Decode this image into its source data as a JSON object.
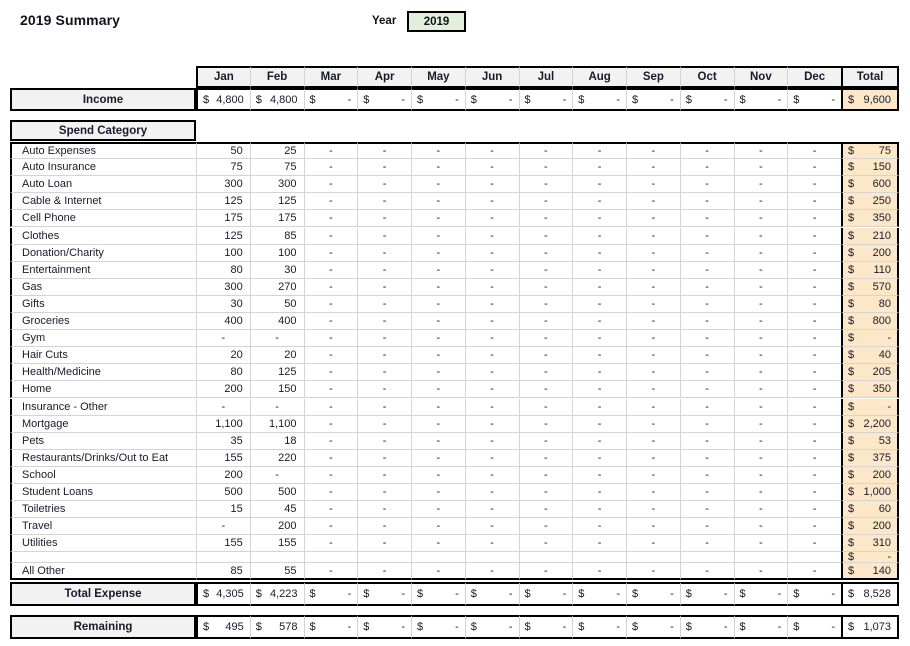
{
  "title": "2019 Summary",
  "year_field": {
    "label": "Year",
    "value": "2019"
  },
  "columns": {
    "months": [
      "Jan",
      "Feb",
      "Mar",
      "Apr",
      "May",
      "Jun",
      "Jul",
      "Aug",
      "Sep",
      "Oct",
      "Nov",
      "Dec"
    ],
    "total": "Total"
  },
  "income": {
    "label": "Income",
    "currency": "$",
    "values": [
      "4,800",
      "4,800",
      "-",
      "-",
      "-",
      "-",
      "-",
      "-",
      "-",
      "-",
      "-",
      "-"
    ],
    "total": "9,600"
  },
  "spend_header": "Spend Category",
  "categories": [
    {
      "name": "Auto Expenses",
      "values": [
        "50",
        "25",
        "-",
        "-",
        "-",
        "-",
        "-",
        "-",
        "-",
        "-",
        "-",
        "-"
      ],
      "total": "75"
    },
    {
      "name": "Auto Insurance",
      "values": [
        "75",
        "75",
        "-",
        "-",
        "-",
        "-",
        "-",
        "-",
        "-",
        "-",
        "-",
        "-"
      ],
      "total": "150"
    },
    {
      "name": "Auto Loan",
      "values": [
        "300",
        "300",
        "-",
        "-",
        "-",
        "-",
        "-",
        "-",
        "-",
        "-",
        "-",
        "-"
      ],
      "total": "600"
    },
    {
      "name": "Cable & Internet",
      "values": [
        "125",
        "125",
        "-",
        "-",
        "-",
        "-",
        "-",
        "-",
        "-",
        "-",
        "-",
        "-"
      ],
      "total": "250"
    },
    {
      "name": "Cell Phone",
      "values": [
        "175",
        "175",
        "-",
        "-",
        "-",
        "-",
        "-",
        "-",
        "-",
        "-",
        "-",
        "-"
      ],
      "total": "350"
    },
    {
      "name": "Clothes",
      "values": [
        "125",
        "85",
        "-",
        "-",
        "-",
        "-",
        "-",
        "-",
        "-",
        "-",
        "-",
        "-"
      ],
      "total": "210"
    },
    {
      "name": "Donation/Charity",
      "values": [
        "100",
        "100",
        "-",
        "-",
        "-",
        "-",
        "-",
        "-",
        "-",
        "-",
        "-",
        "-"
      ],
      "total": "200"
    },
    {
      "name": "Entertainment",
      "values": [
        "80",
        "30",
        "-",
        "-",
        "-",
        "-",
        "-",
        "-",
        "-",
        "-",
        "-",
        "-"
      ],
      "total": "110"
    },
    {
      "name": "Gas",
      "values": [
        "300",
        "270",
        "-",
        "-",
        "-",
        "-",
        "-",
        "-",
        "-",
        "-",
        "-",
        "-"
      ],
      "total": "570"
    },
    {
      "name": "Gifts",
      "values": [
        "30",
        "50",
        "-",
        "-",
        "-",
        "-",
        "-",
        "-",
        "-",
        "-",
        "-",
        "-"
      ],
      "total": "80"
    },
    {
      "name": "Groceries",
      "values": [
        "400",
        "400",
        "-",
        "-",
        "-",
        "-",
        "-",
        "-",
        "-",
        "-",
        "-",
        "-"
      ],
      "total": "800"
    },
    {
      "name": "Gym",
      "values": [
        "-",
        "-",
        "-",
        "-",
        "-",
        "-",
        "-",
        "-",
        "-",
        "-",
        "-",
        "-"
      ],
      "total": "-"
    },
    {
      "name": "Hair Cuts",
      "values": [
        "20",
        "20",
        "-",
        "-",
        "-",
        "-",
        "-",
        "-",
        "-",
        "-",
        "-",
        "-"
      ],
      "total": "40"
    },
    {
      "name": "Health/Medicine",
      "values": [
        "80",
        "125",
        "-",
        "-",
        "-",
        "-",
        "-",
        "-",
        "-",
        "-",
        "-",
        "-"
      ],
      "total": "205"
    },
    {
      "name": "Home",
      "values": [
        "200",
        "150",
        "-",
        "-",
        "-",
        "-",
        "-",
        "-",
        "-",
        "-",
        "-",
        "-"
      ],
      "total": "350"
    },
    {
      "name": "Insurance - Other",
      "values": [
        "-",
        "-",
        "-",
        "-",
        "-",
        "-",
        "-",
        "-",
        "-",
        "-",
        "-",
        "-"
      ],
      "total": "-"
    },
    {
      "name": "Mortgage",
      "values": [
        "1,100",
        "1,100",
        "-",
        "-",
        "-",
        "-",
        "-",
        "-",
        "-",
        "-",
        "-",
        "-"
      ],
      "total": "2,200"
    },
    {
      "name": "Pets",
      "values": [
        "35",
        "18",
        "-",
        "-",
        "-",
        "-",
        "-",
        "-",
        "-",
        "-",
        "-",
        "-"
      ],
      "total": "53"
    },
    {
      "name": "Restaurants/Drinks/Out to Eat",
      "values": [
        "155",
        "220",
        "-",
        "-",
        "-",
        "-",
        "-",
        "-",
        "-",
        "-",
        "-",
        "-"
      ],
      "total": "375"
    },
    {
      "name": "School",
      "values": [
        "200",
        "-",
        "-",
        "-",
        "-",
        "-",
        "-",
        "-",
        "-",
        "-",
        "-",
        "-"
      ],
      "total": "200"
    },
    {
      "name": "Student Loans",
      "values": [
        "500",
        "500",
        "-",
        "-",
        "-",
        "-",
        "-",
        "-",
        "-",
        "-",
        "-",
        "-"
      ],
      "total": "1,000"
    },
    {
      "name": "Toiletries",
      "values": [
        "15",
        "45",
        "-",
        "-",
        "-",
        "-",
        "-",
        "-",
        "-",
        "-",
        "-",
        "-"
      ],
      "total": "60"
    },
    {
      "name": "Travel",
      "values": [
        "-",
        "200",
        "-",
        "-",
        "-",
        "-",
        "-",
        "-",
        "-",
        "-",
        "-",
        "-"
      ],
      "total": "200"
    },
    {
      "name": "Utilities",
      "values": [
        "155",
        "155",
        "-",
        "-",
        "-",
        "-",
        "-",
        "-",
        "-",
        "-",
        "-",
        "-"
      ],
      "total": "310"
    },
    {
      "name": "",
      "values": [
        "",
        "",
        "",
        "",
        "",
        "",
        "",
        "",
        "",
        "",
        "",
        ""
      ],
      "total": "-"
    },
    {
      "name": "All Other",
      "values": [
        "85",
        "55",
        "-",
        "-",
        "-",
        "-",
        "-",
        "-",
        "-",
        "-",
        "-",
        "-"
      ],
      "total": "140"
    }
  ],
  "total_expense": {
    "label": "Total Expense",
    "currency": "$",
    "values": [
      "4,305",
      "4,223",
      "-",
      "-",
      "-",
      "-",
      "-",
      "-",
      "-",
      "-",
      "-",
      "-"
    ],
    "total": "8,528"
  },
  "remaining": {
    "label": "Remaining",
    "currency": "$",
    "values": [
      "495",
      "578",
      "-",
      "-",
      "-",
      "-",
      "-",
      "-",
      "-",
      "-",
      "-",
      "-"
    ],
    "total": "1,073"
  },
  "colors": {
    "total_fill": "#fce8c8",
    "header_fill": "#f2f2f2",
    "year_fill": "#e2efda",
    "text": "#1a1a2e"
  }
}
